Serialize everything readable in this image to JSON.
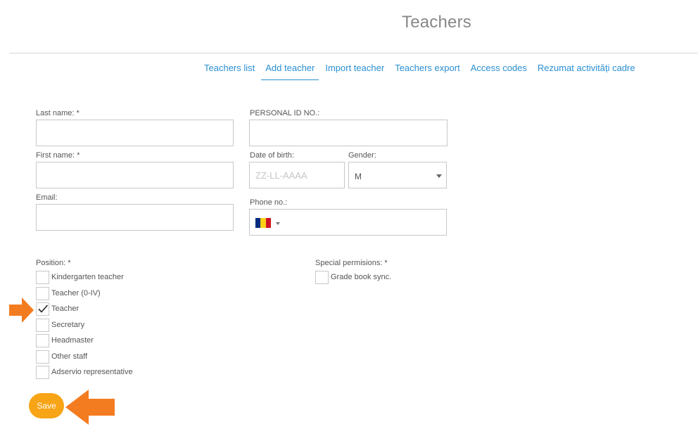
{
  "page": {
    "title": "Teachers"
  },
  "tabs": [
    {
      "label": "Teachers list",
      "active": false
    },
    {
      "label": "Add teacher",
      "active": true
    },
    {
      "label": "Import teacher",
      "active": false
    },
    {
      "label": "Teachers export",
      "active": false
    },
    {
      "label": "Access codes",
      "active": false
    },
    {
      "label": "Rezumat activități cadre",
      "active": false
    }
  ],
  "form": {
    "last_name": {
      "label": "Last name: *",
      "value": ""
    },
    "personal_id": {
      "label": "PERSONAL ID NO.:",
      "value": ""
    },
    "first_name": {
      "label": "First name: *",
      "value": ""
    },
    "date_of_birth": {
      "label": "Date of birth:",
      "placeholder": "ZZ-LL-AAAA",
      "value": ""
    },
    "gender": {
      "label": "Gender:",
      "selected": "M"
    },
    "email": {
      "label": "Email:",
      "value": ""
    },
    "phone": {
      "label": "Phone no.:",
      "country_flag": "romania-flag-icon",
      "flag_colors": [
        "#002b7f",
        "#fcd116",
        "#ce1126"
      ],
      "value": ""
    }
  },
  "position": {
    "label": "Position: *",
    "options": [
      {
        "label": "Kindergarten teacher",
        "checked": false
      },
      {
        "label": "Teacher (0-IV)",
        "checked": false
      },
      {
        "label": "Teacher",
        "checked": true
      },
      {
        "label": "Secretary",
        "checked": false
      },
      {
        "label": "Headmaster",
        "checked": false
      },
      {
        "label": "Other staff",
        "checked": false
      },
      {
        "label": "Adservio representative",
        "checked": false
      }
    ]
  },
  "special_permissions": {
    "label": "Special permisions: *",
    "options": [
      {
        "label": "Grade book sync.",
        "checked": false
      }
    ]
  },
  "actions": {
    "save_label": "Save"
  },
  "colors": {
    "accent_link": "#2a8fd3",
    "save_button": "#f7a417",
    "annotation_arrow": "#f47c20"
  },
  "annotations": [
    "arrow-icon",
    "arrow-icon"
  ]
}
